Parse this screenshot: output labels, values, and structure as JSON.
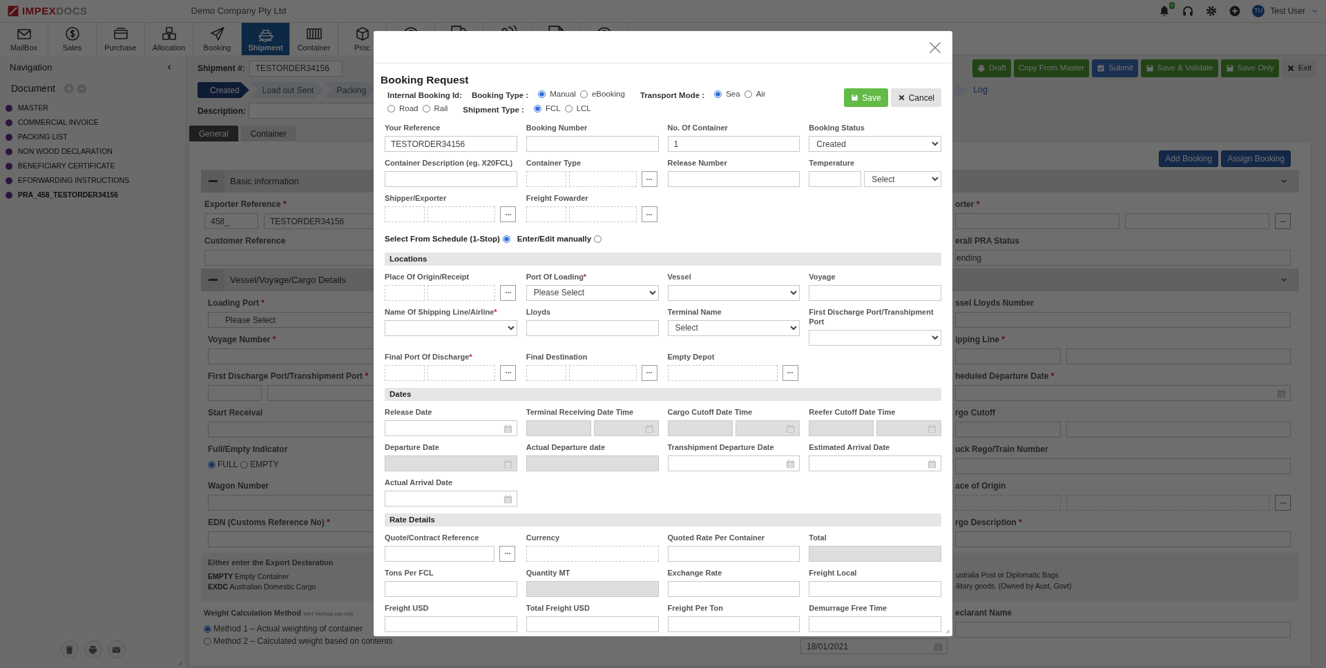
{
  "header": {
    "logo_strong": "IMPEX",
    "logo_light": "DOCS",
    "company": "Demo Company Pty Ltd",
    "notification_count": "0",
    "user_initials": "TU",
    "user_name": "Test User"
  },
  "toolbar": [
    {
      "label": "MailBox",
      "selected": false
    },
    {
      "label": "Sales",
      "selected": false
    },
    {
      "label": "Purchase",
      "selected": false
    },
    {
      "label": "Allocation",
      "selected": false
    },
    {
      "label": "Booking",
      "selected": false
    },
    {
      "label": "Shipment",
      "selected": true
    },
    {
      "label": "Container",
      "selected": false
    },
    {
      "label": "Proc",
      "selected": false
    },
    {
      "selected": false
    },
    {
      "selected": false
    },
    {
      "selected": false
    },
    {
      "selected": false
    },
    {
      "selected": false
    }
  ],
  "navigation": {
    "title": "Navigation",
    "section": "Document",
    "documents": [
      {
        "label": "MASTER",
        "selected": false
      },
      {
        "label": "COMMERCIAL INVOICE",
        "selected": false
      },
      {
        "label": "PACKING LIST",
        "selected": false
      },
      {
        "label": "NON WOOD DECLARATION",
        "selected": false
      },
      {
        "label": "BENEFICIARY CERTIFICATE",
        "selected": false
      },
      {
        "label": "EFORWARDING INSTRUCTIONS",
        "selected": false
      },
      {
        "label": "PRA_458_TESTORDER34156",
        "selected": true
      }
    ]
  },
  "shipment": {
    "label": "Shipment #:",
    "number": "TESTORDER34156",
    "description_label": "Description:"
  },
  "actions": [
    "Draft",
    "Copy From Master",
    "Submit",
    "Save & Validate",
    "Save Only",
    "Exit"
  ],
  "steps": [
    {
      "label": "Created",
      "kind": "chevron",
      "selected": true
    },
    {
      "label": "Load out Sent",
      "kind": "chevron",
      "selected": false
    },
    {
      "label": "Packing",
      "kind": "chevron",
      "selected": false
    },
    {
      "label": "Log",
      "kind": "link",
      "selected": false
    }
  ],
  "tabs": [
    {
      "label": "General",
      "selected": true
    },
    {
      "label": "Container",
      "selected": false
    }
  ],
  "panel_buttons": [
    "Add Booking",
    "Assign Booking"
  ],
  "sections": [
    {
      "title": "Basic information",
      "rows": [
        {
          "left": {
            "label": "Exporter Reference",
            "required_mark": "*",
            "kind": "pair",
            "values": [
              "458_",
              "TESTORDER34156"
            ]
          },
          "right": {
            "label": "orter",
            "required_mark": "*",
            "kind": "pair_lookup"
          }
        },
        {
          "left": {
            "label": "Customer Reference",
            "kind": "text"
          },
          "right": {
            "label": "erall PRA Status",
            "kind": "text",
            "value": "ending"
          }
        }
      ]
    },
    {
      "title": "Vessel/Voyage/Cargo Details",
      "rows": [
        {
          "left": {
            "label": "Loading Port",
            "required_mark": "*",
            "kind": "select",
            "value": "Please Select"
          },
          "right": {
            "label": "ssel Lloyds Number",
            "kind": "text"
          }
        },
        {
          "left": {
            "label": "Voyage Number",
            "required_mark": "*",
            "kind": "text"
          },
          "right": {
            "label": "ipping Line",
            "required_mark": "*",
            "kind": "pair"
          }
        },
        {
          "left": {
            "label": "First Discharge Port/Transhipment Port",
            "required_mark": "*",
            "kind": "pair"
          },
          "right": {
            "label": "heduled Departure Date",
            "required_mark": "*",
            "kind": "date"
          }
        },
        {
          "left": {
            "label": "Start Receival",
            "kind": "text"
          },
          "right": {
            "label": "rgo Cutoff",
            "kind": "pair"
          }
        },
        {
          "left": {
            "label": "Full/Empty Indicator",
            "kind": "radios",
            "options": [
              {
                "label": "FULL",
                "selected": true
              },
              {
                "label": "EMPTY",
                "selected": false
              }
            ]
          },
          "right": {
            "label": "uck Rego/Train Number",
            "kind": "text"
          }
        },
        {
          "left": {
            "label": "Wagon Number",
            "kind": "text"
          },
          "right": {
            "label": "ace of Origin",
            "kind": "dashed_lookup"
          }
        },
        {
          "left": {
            "label": "EDN (Customs Reference No)",
            "required_mark": "*",
            "kind": "text"
          },
          "right": {
            "label": "rgo Description",
            "required_mark": "*",
            "kind": "text"
          }
        }
      ]
    }
  ],
  "notes": {
    "heading": "Either enter the Export Declaration",
    "left_lines": [
      "**EMPTY** Empty Container",
      "**EXDC** Australian Domestic Cargo"
    ],
    "right_lines": [
      "ustralia Post or Diplomatic Bags",
      "ilitary goods. (Owned by Aust, Govt)"
    ]
  },
  "last_row": {
    "left": {
      "label": "Weight Calculation Method",
      "hint": "WAT Method can only",
      "kind": "radios_stacked",
      "options": [
        {
          "label": "Method 1 – Actual weighting of container",
          "selected": true
        },
        {
          "label": "Method 2 – Calculated weight based on contents",
          "selected": false
        }
      ]
    },
    "middle": {
      "kind": "date",
      "value": "18/01/2021"
    },
    "right": {
      "label": "eclarant Name",
      "kind": "text"
    }
  },
  "modal": {
    "title": "Booking Request",
    "save": "Save",
    "cancel": "Cancel",
    "header": [
      {
        "kind": "label",
        "text": "Internal Booking Id:"
      },
      {
        "kind": "group",
        "label": "Booking Type :",
        "options": [
          {
            "label": "Manual",
            "selected": true
          },
          {
            "label": "eBooking",
            "selected": false
          }
        ]
      },
      {
        "kind": "group",
        "label": "Transport Mode :",
        "options": [
          {
            "label": "Sea",
            "selected": true
          },
          {
            "label": "Air",
            "selected": false
          },
          {
            "label": "Road",
            "selected": false
          },
          {
            "label": "Rail",
            "selected": false
          }
        ]
      },
      {
        "kind": "group",
        "label": "Shipment Type :",
        "options": [
          {
            "label": "FCL",
            "selected": true
          },
          {
            "label": "LCL",
            "selected": false
          }
        ]
      }
    ],
    "blocks": [
      {
        "kind": "fields",
        "fields": [
          {
            "label": "Your Reference",
            "kind": "text",
            "value": "TESTORDER34156",
            "disabled": false
          },
          {
            "label": "Booking Number",
            "kind": "text",
            "disabled": false
          },
          {
            "label": "No. Of Container",
            "kind": "text",
            "value": "1",
            "disabled": false
          },
          {
            "label": "Booking Status",
            "kind": "select",
            "value": "Created",
            "disabled": false
          },
          {
            "label": "Container Description (eg. X20FCL)",
            "kind": "text",
            "disabled": false
          },
          {
            "label": "Container Type",
            "kind": "lookup",
            "disabled": false
          },
          {
            "label": "Release Number",
            "kind": "text",
            "disabled": false
          },
          {
            "label": "Temperature",
            "kind": "temperature",
            "value": "Select",
            "disabled": false
          },
          {
            "label": "Shipper/Exporter",
            "kind": "lookup",
            "disabled": false
          },
          {
            "label": "Freight Fowarder",
            "kind": "lookup",
            "disabled": false
          }
        ]
      },
      {
        "kind": "schedule",
        "options": [
          {
            "label": "Select From Schedule (1-Stop)",
            "selected": true
          },
          {
            "label": "Enter/Edit manually",
            "selected": false
          }
        ]
      },
      {
        "kind": "heading",
        "text": "Locations"
      },
      {
        "kind": "fields",
        "fields": [
          {
            "label": "Place Of Origin/Receipt",
            "kind": "lookup",
            "disabled": false
          },
          {
            "label": "Port Of Loading",
            "required_mark": "*",
            "kind": "select",
            "value": "Please Select",
            "disabled": false
          },
          {
            "label": "Vessel",
            "kind": "select",
            "disabled": false
          },
          {
            "label": "Voyage",
            "kind": "text",
            "disabled": false
          },
          {
            "label": "Name Of Shipping Line/Airline",
            "required_mark": "*",
            "kind": "select",
            "disabled": false
          },
          {
            "label": "Lloyds",
            "kind": "text",
            "disabled": false
          },
          {
            "label": "Terminal Name",
            "kind": "select",
            "value": "Select",
            "disabled": false
          },
          {
            "label": "First Discharge Port/Transhipment Port",
            "kind": "select",
            "disabled": false
          },
          {
            "label": "Final Port Of Discharge",
            "required_mark": "*",
            "kind": "lookup",
            "disabled": false
          },
          {
            "label": "Final Destination",
            "kind": "lookup",
            "disabled": false
          },
          {
            "label": "Empty Depot",
            "kind": "lookup_wide",
            "disabled": false
          }
        ]
      },
      {
        "kind": "heading",
        "text": "Dates"
      },
      {
        "kind": "fields",
        "fields": [
          {
            "label": "Release Date",
            "kind": "date",
            "disabled": false
          },
          {
            "label": "Terminal Receiving Date Time",
            "kind": "datetime",
            "disabled": true
          },
          {
            "label": "Cargo Cutoff Date Time",
            "kind": "datetime",
            "disabled": true
          },
          {
            "label": "Reefer Cutoff Date Time",
            "kind": "datetime",
            "disabled": true
          },
          {
            "label": "Departure Date",
            "kind": "date",
            "disabled": true
          },
          {
            "label": "Actual Departure date",
            "kind": "text",
            "disabled": true
          },
          {
            "label": "Transhipment Departure Date",
            "kind": "date",
            "disabled": false
          },
          {
            "label": "Estimated Arrival Date",
            "kind": "date",
            "disabled": false
          },
          {
            "label": "Actual Arrival Date",
            "kind": "date",
            "disabled": false
          }
        ]
      },
      {
        "kind": "heading",
        "text": "Rate Details"
      },
      {
        "kind": "fields",
        "fields": [
          {
            "label": "Quote/Contract Reference",
            "kind": "lookup_solid",
            "disabled": false
          },
          {
            "label": "Currency",
            "kind": "dashed",
            "disabled": false
          },
          {
            "label": "Quoted Rate Per Container",
            "kind": "text",
            "disabled": false
          },
          {
            "label": "Total",
            "kind": "text",
            "disabled": true
          },
          {
            "label": "Tons Per FCL",
            "kind": "text",
            "disabled": false
          },
          {
            "label": "Quantity MT",
            "kind": "text",
            "disabled": true
          },
          {
            "label": "Exchange Rate",
            "kind": "text",
            "disabled": false
          },
          {
            "label": "Freight Local",
            "kind": "text",
            "disabled": false
          },
          {
            "label": "Freight USD",
            "kind": "text",
            "disabled": false
          },
          {
            "label": "Total Freight USD",
            "kind": "text",
            "disabled": false
          },
          {
            "label": "Freight Per Ton",
            "kind": "text",
            "disabled": false
          },
          {
            "label": "Demurrage Free Time",
            "kind": "text",
            "disabled": false
          }
        ]
      }
    ]
  }
}
